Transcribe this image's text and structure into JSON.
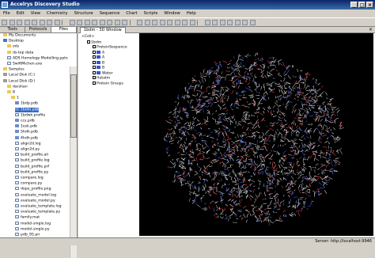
{
  "window": {
    "title": "Accelrys Discovery Studio",
    "minimize": "_",
    "maximize": "□",
    "close": "×"
  },
  "menu": [
    "File",
    "Edit",
    "View",
    "Chemistry",
    "Structure",
    "Sequence",
    "Chart",
    "Scripts",
    "Window",
    "Help"
  ],
  "left_panel": {
    "tabs": [
      "Tools",
      "Protocols",
      "Files"
    ],
    "active_tab": "Files",
    "tree": [
      {
        "label": "My Documents",
        "icon": "folder",
        "level": 0
      },
      {
        "label": "Desktop",
        "icon": "desktop",
        "level": 0
      },
      {
        "label": "ods",
        "icon": "folder",
        "level": 1
      },
      {
        "label": "ds-top data",
        "icon": "folder",
        "level": 1
      },
      {
        "label": "ADS Homology Modelling.pptx",
        "icon": "doc",
        "level": 1
      },
      {
        "label": "SwiftMichen.exe",
        "icon": "doc",
        "level": 1
      },
      {
        "label": "Samples",
        "icon": "folder",
        "level": 0
      },
      {
        "label": "Local Disk (C:)",
        "icon": "drive",
        "level": 0
      },
      {
        "label": "Local Disk (D:)",
        "icon": "drive",
        "level": 0
      },
      {
        "label": "darshan",
        "icon": "folder",
        "level": 1
      },
      {
        "label": "8",
        "icon": "folder",
        "level": 1
      },
      {
        "label": "1",
        "icon": "folder",
        "level": 2
      },
      {
        "label": "1bdp.pdb",
        "icon": "pdb",
        "level": 3
      },
      {
        "label": "1bdm.pdb",
        "icon": "pdb",
        "level": 3
      },
      {
        "label": "1bdwk.profile",
        "icon": "doc",
        "level": 3
      },
      {
        "label": "ccs.pdb",
        "icon": "pdb",
        "level": 3
      },
      {
        "label": "1esk.pdb",
        "icon": "pdb",
        "level": 3
      },
      {
        "label": "5hdh.pdb",
        "icon": "pdb",
        "level": 3
      },
      {
        "label": "4hdh.pdb",
        "icon": "pdb",
        "level": 3
      },
      {
        "label": "align2d.log",
        "icon": "doc",
        "level": 3
      },
      {
        "label": "align2d.py",
        "icon": "doc",
        "level": 3
      },
      {
        "label": "build_profile.ali",
        "icon": "doc",
        "level": 3
      },
      {
        "label": "build_profile.log",
        "icon": "doc",
        "level": 3
      },
      {
        "label": "build_profile.prf",
        "icon": "doc",
        "level": 3
      },
      {
        "label": "build_profile.py",
        "icon": "doc",
        "level": 3
      },
      {
        "label": "compare.log",
        "icon": "doc",
        "level": 3
      },
      {
        "label": "compare.py",
        "icon": "doc",
        "level": 3
      },
      {
        "label": "dope_profile.png",
        "icon": "doc",
        "level": 3
      },
      {
        "label": "evaluate_model.log",
        "icon": "doc",
        "level": 3
      },
      {
        "label": "evaluate_model.py",
        "icon": "doc",
        "level": 3
      },
      {
        "label": "evaluate_template.log",
        "icon": "doc",
        "level": 3
      },
      {
        "label": "evaluate_template.py",
        "icon": "doc",
        "level": 3
      },
      {
        "label": "family.mat",
        "icon": "doc",
        "level": 3
      },
      {
        "label": "model-single.log",
        "icon": "doc",
        "level": 3
      },
      {
        "label": "model-single.py",
        "icon": "doc",
        "level": 3
      },
      {
        "label": "pdb_95.pir",
        "icon": "doc",
        "level": 3
      }
    ],
    "selected": "1bdm.pdb"
  },
  "document": {
    "tab_label": "1bdm - 3D Window",
    "close": "×",
    "hierarchy": [
      {
        "label": "<Cell>",
        "level": 0,
        "type": "plain"
      },
      {
        "label": "1bdm",
        "level": 1,
        "type": "check"
      },
      {
        "label": "ProteinSequence",
        "level": 2,
        "type": "check"
      },
      {
        "label": "A",
        "level": 2,
        "type": "chain"
      },
      {
        "label": "A",
        "level": 2,
        "type": "chain"
      },
      {
        "label": "B",
        "level": 2,
        "type": "chain"
      },
      {
        "label": "B",
        "level": 2,
        "type": "chain"
      },
      {
        "label": "Water",
        "level": 2,
        "type": "chain"
      },
      {
        "label": "Hetatm",
        "level": 2,
        "type": "check"
      },
      {
        "label": "Protein Groups",
        "level": 2,
        "type": "check"
      }
    ]
  },
  "status": {
    "server": "Server: http://localhost:9946"
  },
  "colors": {
    "viewer_bg": "#000000",
    "selection": "#316ac5",
    "title_bar": "#0a246a"
  }
}
